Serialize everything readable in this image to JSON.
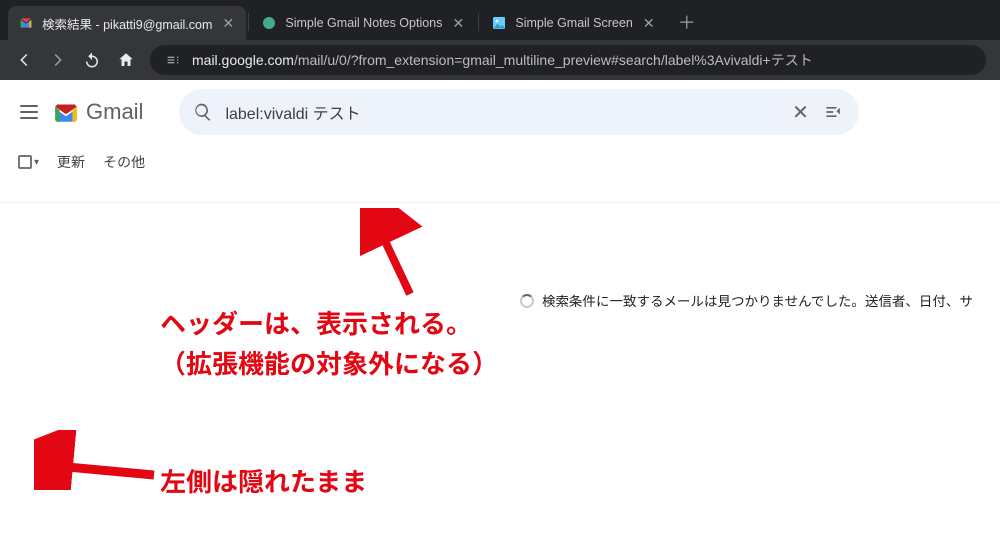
{
  "browser": {
    "tabs": [
      {
        "title": "検索結果 - pikatti9@gmail.com",
        "active": true,
        "favicon": "gmail"
      },
      {
        "title": "Simple Gmail Notes Options",
        "active": false,
        "favicon": "ext"
      },
      {
        "title": "Simple Gmail Screen",
        "active": false,
        "favicon": "img"
      }
    ],
    "url_host": "mail.google.com",
    "url_path": "/mail/u/0/?from_extension=gmail_multiline_preview#search/label%3Avivaldi+テスト"
  },
  "gmail": {
    "brand": "Gmail",
    "search_query": "label:vivaldi テスト",
    "toolbar": {
      "refresh": "更新",
      "more": "その他"
    },
    "no_results_text": "検索条件に一致するメールは見つかりませんでした。送信者、日付、サ"
  },
  "annotations": {
    "line1": "ヘッダーは、表示される。",
    "line2": "（拡張機能の対象外になる）",
    "line3": "左側は隠れたまま"
  }
}
